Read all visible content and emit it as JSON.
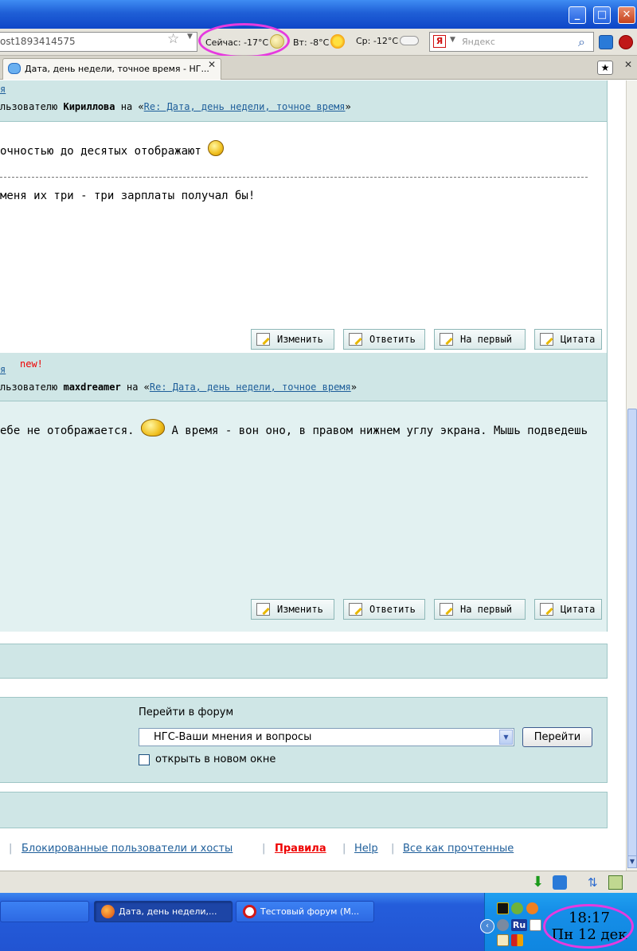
{
  "browser": {
    "url": "ost1893414575",
    "weather": {
      "now": "Сейчас: -17°C",
      "tue": "Вт: -8°C",
      "wed": "Ср: -12°C"
    },
    "search_placeholder": "Яндекс",
    "tab_title": "Дата, день недели, точное время - НГ..."
  },
  "posts": [
    {
      "header_link": "я",
      "reply_prefix": "льзователю",
      "reply_to": "Кириллова",
      "reply_mid": "на «",
      "reply_subject": "Re: Дата, день недели, точное время",
      "reply_end": "»",
      "line1": "очностью до десятых отображают",
      "line2": "меня их три - три зарплаты получал бы!",
      "buttons": [
        "Изменить",
        "Ответить",
        "На первый",
        "Цитата"
      ]
    },
    {
      "header_link": "я",
      "new_badge": "new!",
      "reply_prefix": "льзователю",
      "reply_to": "maxdreamer",
      "reply_mid": "на «",
      "reply_subject": "Re: Дата, день недели, точное время",
      "reply_end": "»",
      "line1a": "ебе не отображается.",
      "line1b": "А время - вон оно, в правом нижнем углу экрана. Мышь подведешь",
      "buttons": [
        "Изменить",
        "Ответить",
        "На первый",
        "Цитата"
      ]
    }
  ],
  "forum_jump": {
    "label": "Перейти в форум",
    "selected": "НГС-Ваши мнения и вопросы",
    "go": "Перейти",
    "new_window": "открыть в новом окне"
  },
  "footer": {
    "blocked": "Блокированные пользователи и хосты",
    "rules": "Правила",
    "help": "Help",
    "mark_read": "Все как прочтенные",
    "separator": "|"
  },
  "taskbar": {
    "tasks": [
      "Дата, день недели,...",
      "Тестовый форум (М..."
    ],
    "lang": "Ru",
    "time": "18:17",
    "date": "Пн 12 дек"
  }
}
